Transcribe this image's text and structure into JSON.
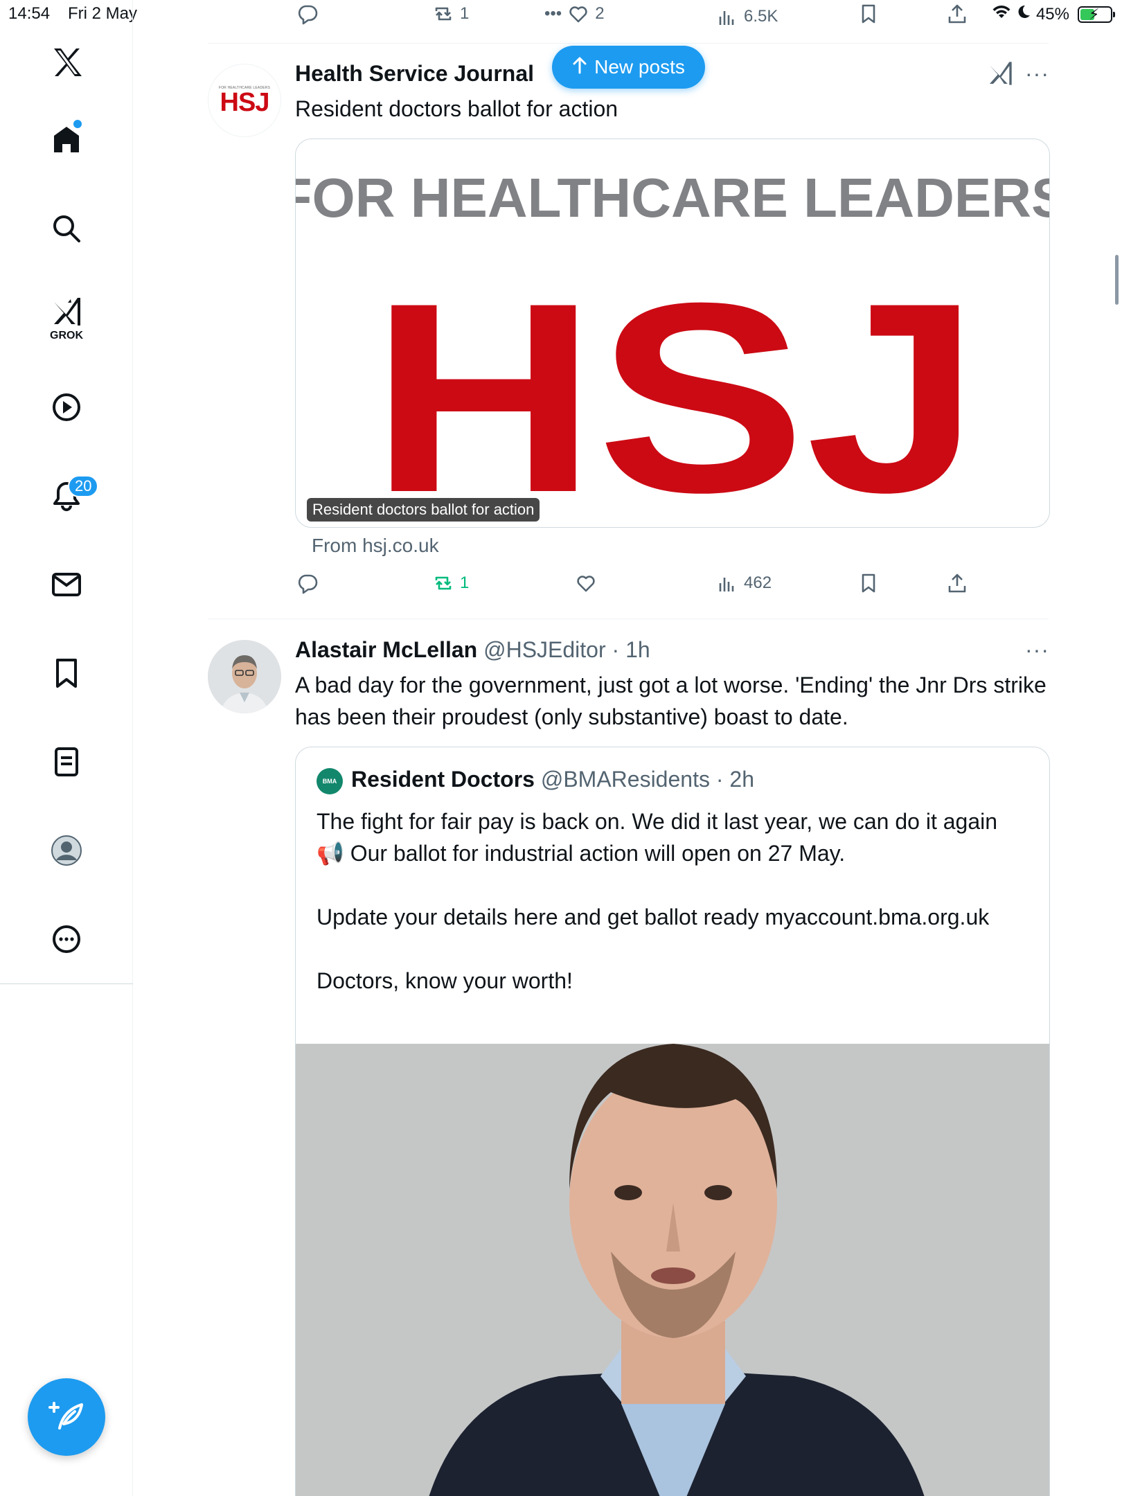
{
  "status_bar": {
    "time": "14:54",
    "date": "Fri 2 May",
    "battery": "45%"
  },
  "sidebar": {
    "items": [
      {
        "icon": "x-logo-icon"
      },
      {
        "icon": "home-icon"
      },
      {
        "icon": "search-icon"
      },
      {
        "icon": "grok-icon",
        "label": "GROK"
      },
      {
        "icon": "video-icon"
      },
      {
        "icon": "notifications-icon",
        "badge": "20"
      },
      {
        "icon": "messages-icon"
      },
      {
        "icon": "bookmarks-icon"
      },
      {
        "icon": "lists-icon"
      },
      {
        "icon": "profile-icon"
      },
      {
        "icon": "more-icon"
      }
    ],
    "compose_icon": "compose-icon"
  },
  "prev_tweet_actions": {
    "retweets": "1",
    "likes": "2",
    "views": "6.5K"
  },
  "new_posts_label": "New posts",
  "tweet1": {
    "name": "Health Service Journal",
    "text": "Resident doctors ballot for action",
    "card": {
      "logo_top": "FOR HEALTHCARE LEADERS",
      "logo_main": "HSJ",
      "caption": "Resident doctors ballot for action",
      "source": "From hsj.co.uk"
    },
    "avatar": {
      "small": "FOR HEALTHCARE LEADERS",
      "big": "HSJ"
    },
    "actions": {
      "retweets": "1",
      "views": "462"
    }
  },
  "tweet2": {
    "name": "Alastair McLellan",
    "handle": "@HSJEditor",
    "time": "1h",
    "text": "A bad day for the government, just got a lot worse. 'Ending' the Jnr Drs strike has been their proudest (only substantive) boast to date.",
    "quote": {
      "avatar_label": "BMA",
      "name": "Resident Doctors",
      "handle": "@BMAResidents",
      "time": "2h",
      "lines": [
        "The fight for fair pay is back on. We did it last year, we can do it again 📢 Our ballot for industrial action will open on 27 May.",
        "",
        "Update your details here and get ballot ready myaccount.bma.org.uk",
        "",
        "Doctors, know your worth!"
      ]
    }
  },
  "colors": {
    "accent": "#1d9bf0",
    "retweet_active": "#00ba7c",
    "hsj_red": "#cc0a14",
    "hsj_grey": "#808285"
  }
}
